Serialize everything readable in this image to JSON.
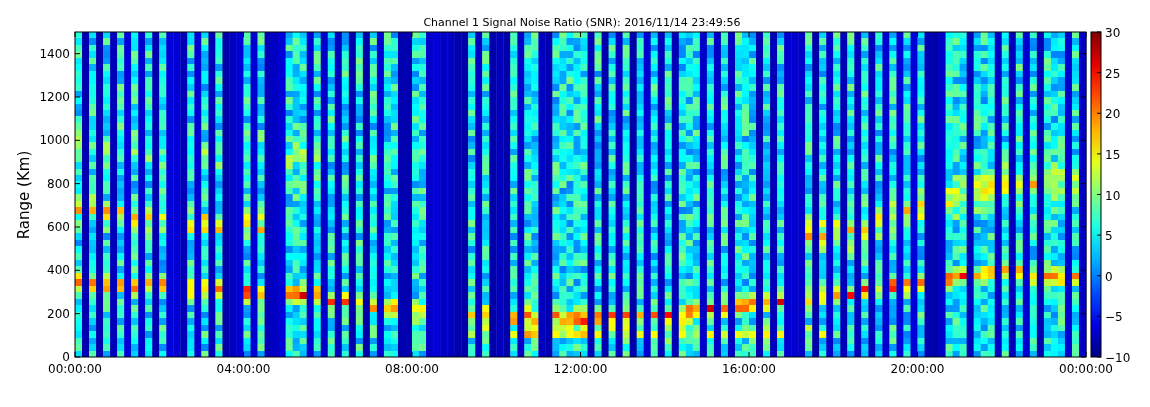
{
  "chart": {
    "title": "Channel 1 Signal Noise Ratio (SNR): 2016/11/14 23:49:56",
    "ylabel": "Range (Km)",
    "xticks": [
      "00:00:00",
      "04:00:00",
      "08:00:00",
      "12:00:00",
      "16:00:00",
      "20:00:00",
      "00:00:00"
    ],
    "yticks": [
      "1400",
      "1200",
      "1000",
      "800",
      "600",
      "400",
      "200",
      "0"
    ]
  },
  "colorbar": {
    "ticks": [
      "30",
      "25",
      "20",
      "15",
      "10",
      "5",
      "0",
      "−5",
      "−10"
    ]
  }
}
